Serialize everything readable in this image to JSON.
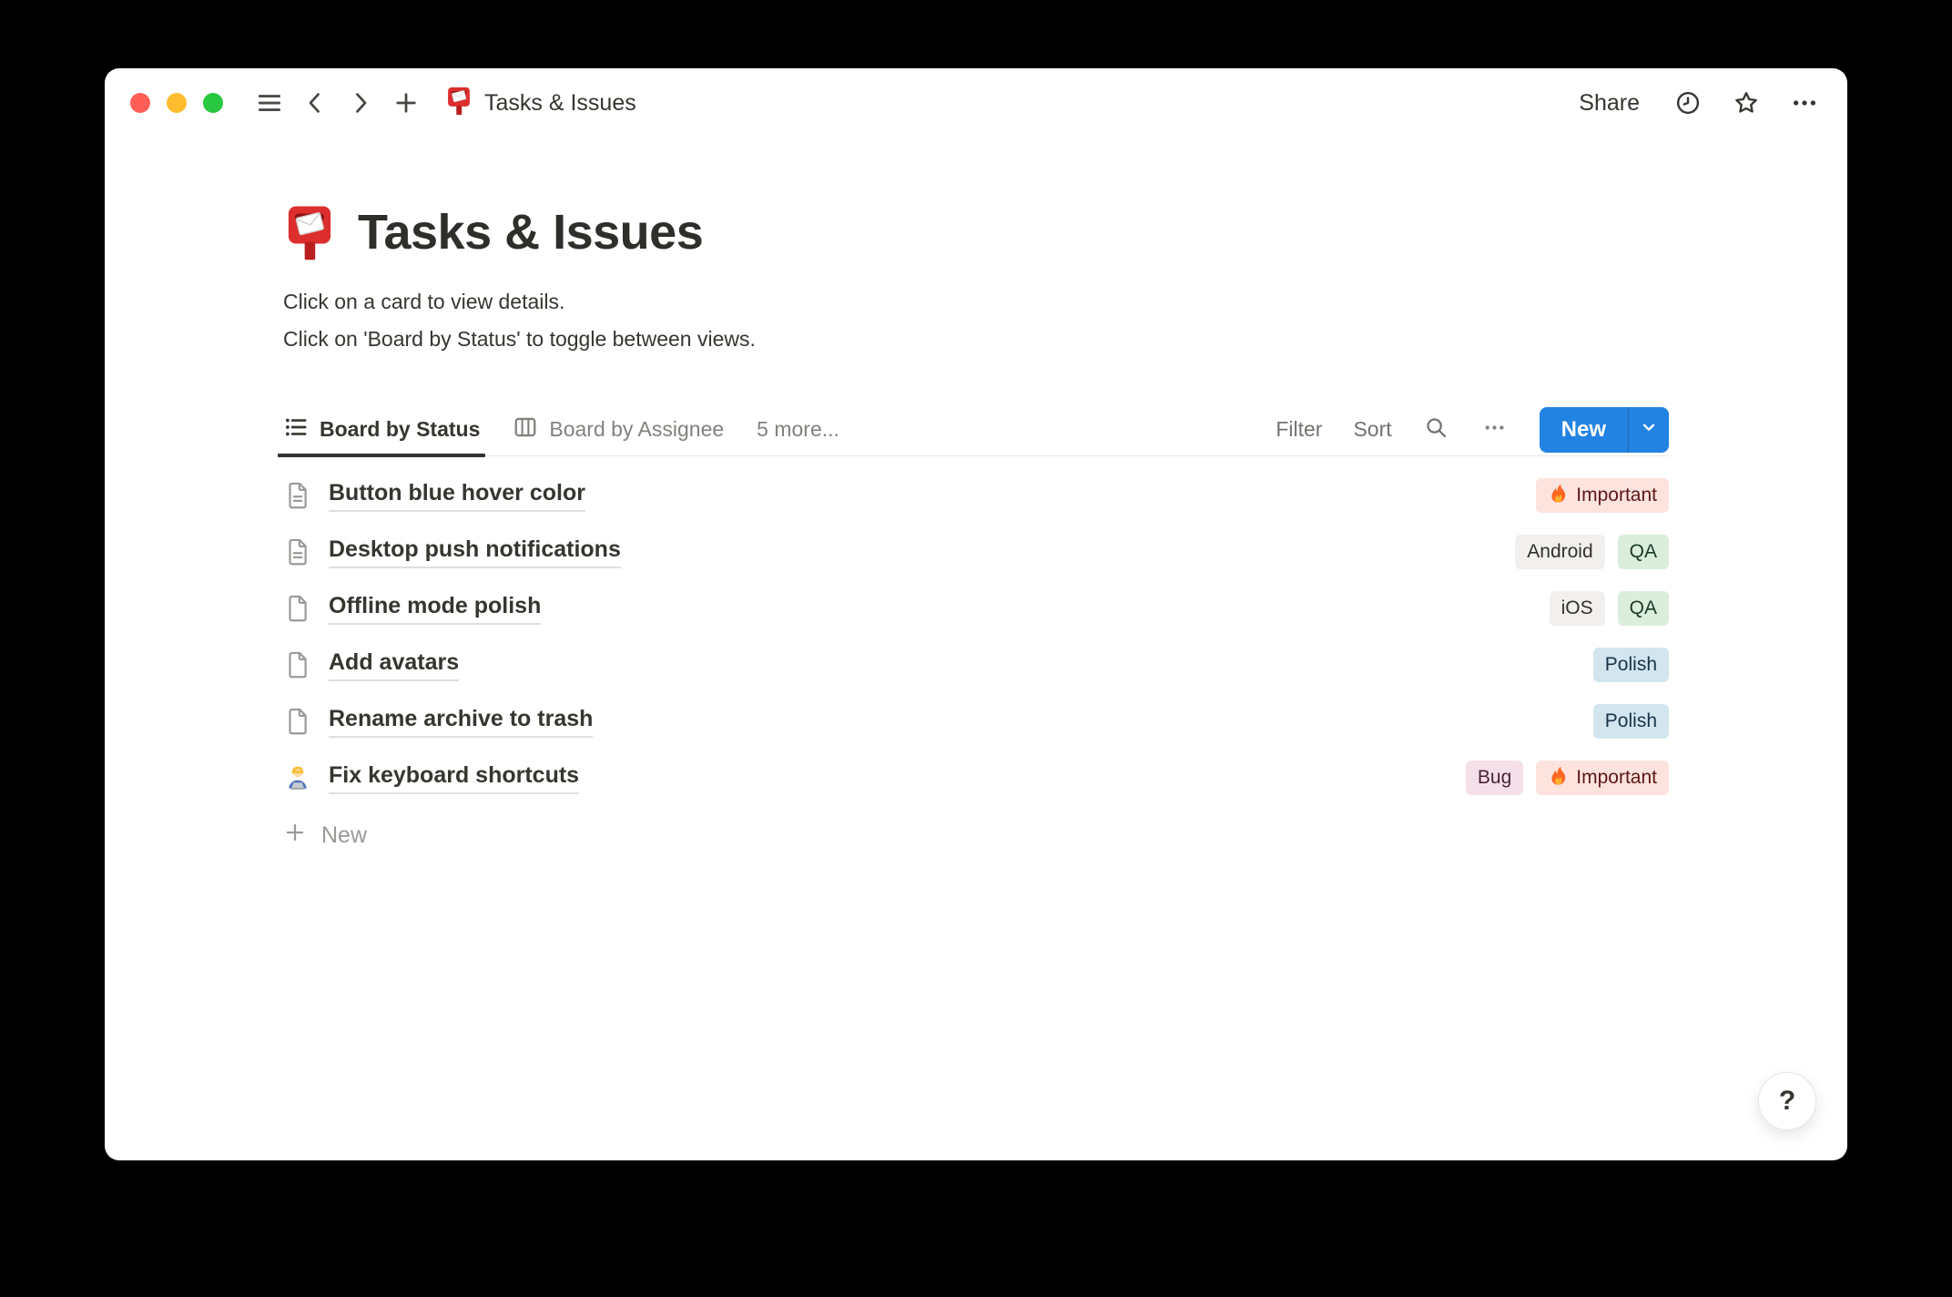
{
  "titlebar": {
    "title": "Tasks & Issues",
    "doc_icon": "postbox-icon",
    "share_label": "Share"
  },
  "page": {
    "icon": "postbox-icon",
    "title": "Tasks & Issues",
    "description_lines": [
      "Click on a card to view details.",
      "Click on 'Board by Status' to toggle between views."
    ]
  },
  "toolbar": {
    "tabs": [
      {
        "label": "Board by Status",
        "icon": "list-view-icon",
        "active": true
      },
      {
        "label": "Board by Assignee",
        "icon": "board-view-icon",
        "active": false
      }
    ],
    "more_label": "5 more...",
    "filter_label": "Filter",
    "sort_label": "Sort",
    "new_label": "New",
    "accent_color": "#2383e2"
  },
  "list": {
    "rows": [
      {
        "icon": "doc-text-icon",
        "title": "Button blue hover color",
        "tags": [
          {
            "label": "Important",
            "icon": "fire-icon",
            "bg": "#fde3de",
            "fg": "#5d1715"
          }
        ]
      },
      {
        "icon": "doc-text-icon",
        "title": "Desktop push notifications",
        "tags": [
          {
            "label": "Android",
            "bg": "#f1f0ee",
            "fg": "#32302c"
          },
          {
            "label": "QA",
            "bg": "#dbeddb",
            "fg": "#1c3829"
          }
        ]
      },
      {
        "icon": "doc-blank-icon",
        "title": "Offline mode polish",
        "tags": [
          {
            "label": "iOS",
            "bg": "#f1f0ee",
            "fg": "#32302c"
          },
          {
            "label": "QA",
            "bg": "#dbeddb",
            "fg": "#1c3829"
          }
        ]
      },
      {
        "icon": "doc-blank-icon",
        "title": "Add avatars",
        "tags": [
          {
            "label": "Polish",
            "bg": "#d3e5ef",
            "fg": "#183347"
          }
        ]
      },
      {
        "icon": "doc-blank-icon",
        "title": "Rename archive to trash",
        "tags": [
          {
            "label": "Polish",
            "bg": "#d3e5ef",
            "fg": "#183347"
          }
        ]
      },
      {
        "icon": "technologist-icon",
        "title": "Fix keyboard shortcuts",
        "tags": [
          {
            "label": "Bug",
            "bg": "#f5e0e9",
            "fg": "#4c2337"
          },
          {
            "label": "Important",
            "icon": "fire-icon",
            "bg": "#fde3de",
            "fg": "#5d1715"
          }
        ]
      }
    ],
    "new_label": "New"
  },
  "help": {
    "label": "?"
  }
}
